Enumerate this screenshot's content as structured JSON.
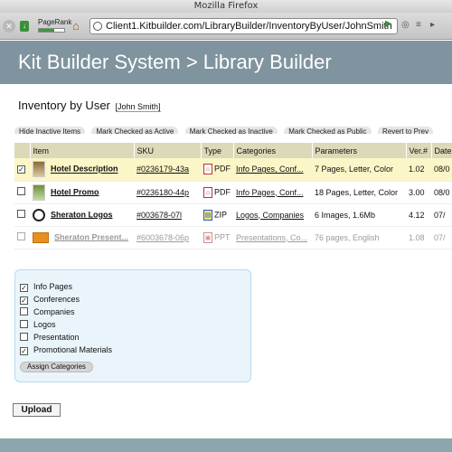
{
  "browser": {
    "window_title": "Mozilla Firefox",
    "pagerank_label": "PageRank",
    "pagerank_level": 0.6,
    "url": "Client1.Kitbuilder.com/LibraryBuilder/InventoryByUser/JohnSmith"
  },
  "header": {
    "title": "Kit Builder System > Library Builder"
  },
  "page": {
    "title": "Inventory by User",
    "user_link": "[John Smith]"
  },
  "actions": [
    "Hide Inactive Items",
    "Mark Checked as Active",
    "Mark Checked as Inactive",
    "Mark Checked as Public",
    "Revert to Prev"
  ],
  "table": {
    "headers": [
      "Item",
      "SKU",
      "Type",
      "Categories",
      "Parameters",
      "Ver.#",
      "Date"
    ],
    "rows": [
      {
        "checked": "✓",
        "item": "Hotel Description",
        "sku": "#0236179-43a",
        "type": "PDF",
        "categories": "Info Pages, Conf...",
        "parameters": "7 Pages, Letter, Color",
        "ver": "1.02",
        "date": "08/0"
      },
      {
        "checked": "",
        "item": "Hotel Promo",
        "sku": "#0236180-44p",
        "type": "PDF",
        "categories": "Info Pages, Conf...",
        "parameters": "18 Pages, Letter, Color",
        "ver": "3.00",
        "date": "08/0"
      },
      {
        "checked": "",
        "item": "Sheraton Logos",
        "sku": "#003678-07l",
        "type": "ZIP",
        "categories": "Logos, Companies",
        "parameters": "6 Images, 1.6Mb",
        "ver": "4.12",
        "date": "07/"
      },
      {
        "checked": "",
        "item": "Sheraton Present...",
        "sku": "#6003678-06p",
        "type": "PPT",
        "categories": "Presentations, Co...",
        "parameters": "76 pages, English",
        "ver": "1.08",
        "date": "07/"
      }
    ]
  },
  "categories": [
    {
      "label": "Info Pages",
      "checked": "✓"
    },
    {
      "label": "Conferences",
      "checked": "✓"
    },
    {
      "label": "Companies",
      "checked": ""
    },
    {
      "label": "Logos",
      "checked": ""
    },
    {
      "label": "Presentation",
      "checked": ""
    },
    {
      "label": "Promotional Materials",
      "checked": "✓"
    }
  ],
  "assign_button": "Assign Categories",
  "upload_button": "Upload"
}
